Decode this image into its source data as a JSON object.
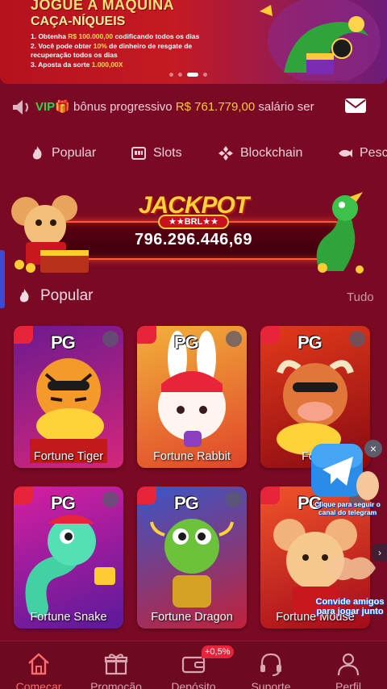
{
  "banner": {
    "title": "JOGUE A MÁQUINA",
    "subtitle": "CAÇA-NÍQUEIS",
    "line1_pre": "1. Obtenha ",
    "line1_amount": "R$ 100.000,00",
    "line1_post": " codificando todos os dias",
    "line2_pre": "2. Você pode obter ",
    "line2_amount": "10%",
    "line2_post": " de dinheiro de resgate de recuperação todos os dias",
    "line3_pre": "3. Aposta da sorte ",
    "line3_amount": "1.000,00X"
  },
  "marquee": {
    "vip": "VIP",
    "text_pre": "bônus progressivo ",
    "amount": "R$ 761.779,00",
    "text_post": "   salário ser"
  },
  "categories": [
    {
      "label": "Popular",
      "icon": "fire-icon"
    },
    {
      "label": "Slots",
      "icon": "slot-machine-icon"
    },
    {
      "label": "Blockchain",
      "icon": "blockchain-icon"
    },
    {
      "label": "Pesc",
      "icon": "fish-icon"
    }
  ],
  "jackpot": {
    "title": "JACKPOT",
    "currency": "★★BRL★★",
    "value": "796.296.446,69"
  },
  "section": {
    "title": "Popular",
    "more": "Tudo"
  },
  "games": [
    {
      "name": "Fortune Tiger",
      "provider": "PG",
      "color": "#7a1c6e"
    },
    {
      "name": "Fortune Rabbit",
      "provider": "PG",
      "color": "#c9a02a"
    },
    {
      "name": "Fortu",
      "provider": "PG",
      "color": "#c6161c"
    },
    {
      "name": "Fortune Snake",
      "provider": "PG",
      "color": "#b5138e"
    },
    {
      "name": "Fortune Dragon",
      "provider": "PG",
      "color": "#2e8a2a"
    },
    {
      "name": "Fortune Mouse",
      "provider": "PG",
      "color": "#d22a1c"
    }
  ],
  "telegram": {
    "close": "×",
    "text": "Clique para seguir o canal do telegram",
    "invite": "Convide amigos para jogar junto",
    "arrow": "›"
  },
  "nav": {
    "items": [
      {
        "label": "Começar",
        "icon": "home-icon",
        "active": true
      },
      {
        "label": "Promoção",
        "icon": "gift-icon",
        "active": false
      },
      {
        "label": "Depósito",
        "icon": "wallet-icon",
        "active": false
      },
      {
        "label": "Suporte",
        "icon": "headset-icon",
        "active": false
      },
      {
        "label": "Perfil",
        "icon": "user-icon",
        "active": false
      }
    ],
    "deposit_badge": "+0,5%"
  },
  "colors": {
    "background": "#7a0a23",
    "accent": "#ff6b6b",
    "gold": "#ffc93a",
    "vip_green": "#36d14a"
  }
}
